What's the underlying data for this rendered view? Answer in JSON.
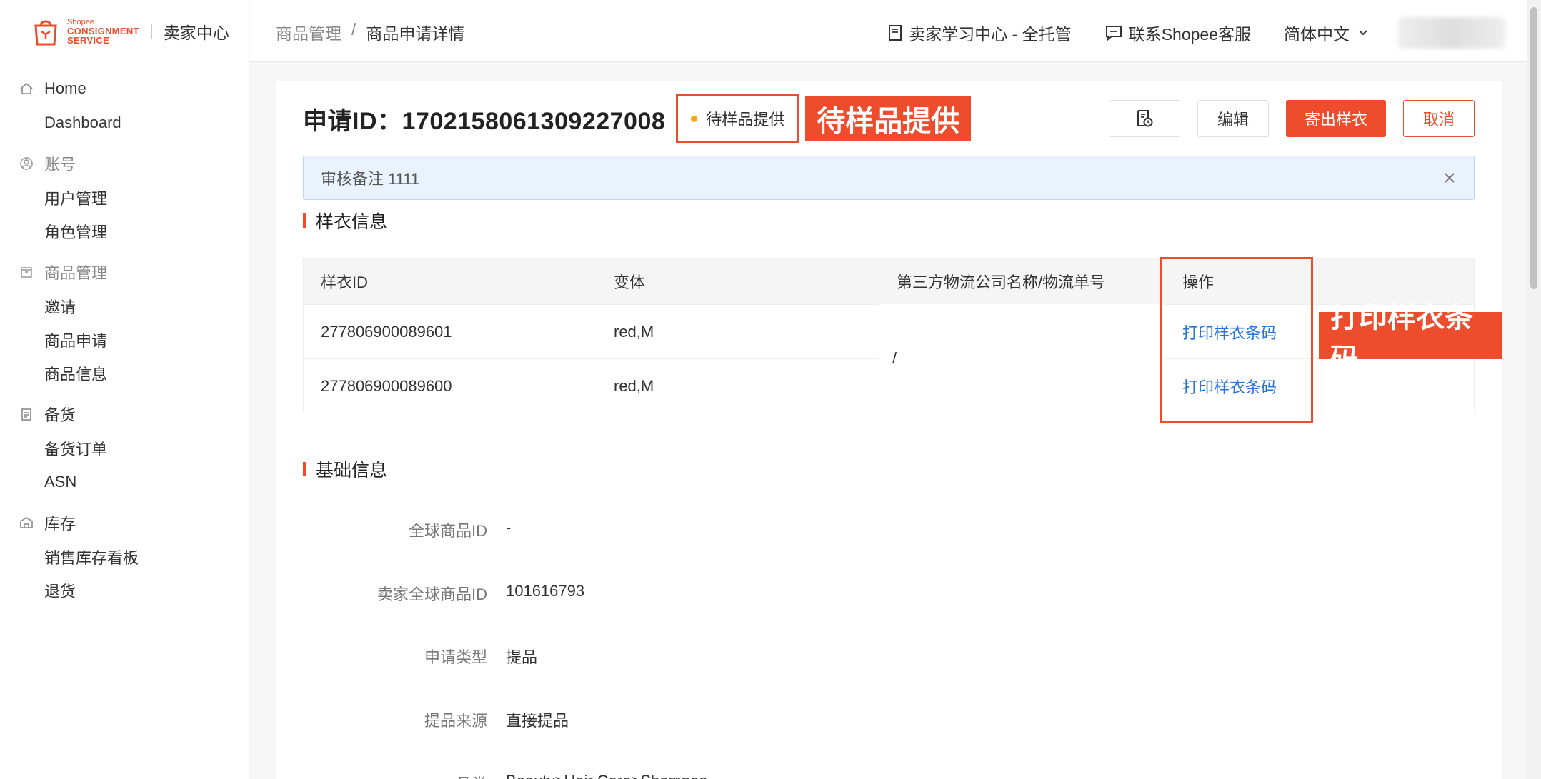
{
  "brand": {
    "logo_small": "Shopee",
    "logo_line1": "CONSIGNMENT",
    "logo_line2": "SERVICE",
    "title": "卖家中心"
  },
  "sidebar": {
    "groups": [
      {
        "label": "Home",
        "icon": "home-icon",
        "muted": false,
        "items": [
          "Dashboard"
        ]
      },
      {
        "label": "账号",
        "icon": "user-circle-icon",
        "muted": true,
        "items": [
          "用户管理",
          "角色管理"
        ]
      },
      {
        "label": "商品管理",
        "icon": "box-icon",
        "muted": true,
        "items": [
          "邀请",
          "商品申请",
          "商品信息"
        ]
      },
      {
        "label": "备货",
        "icon": "clipboard-icon",
        "muted": false,
        "items": [
          "备货订单",
          "ASN"
        ]
      },
      {
        "label": "库存",
        "icon": "warehouse-icon",
        "muted": false,
        "items": [
          "销售库存看板",
          "退货"
        ]
      }
    ]
  },
  "header": {
    "breadcrumb_parent": "商品管理",
    "breadcrumb_sep": "/",
    "breadcrumb_current": "商品申请详情",
    "learning_center": "卖家学习中心 - 全托管",
    "contact_support": "联系Shopee客服",
    "language": "简体中文"
  },
  "detail": {
    "title": "申请ID：1702158061309227008",
    "status": "待样品提供",
    "status_callout": "待样品提供",
    "buttons": {
      "edit": "编辑",
      "ship_sample": "寄出样衣",
      "cancel": "取消"
    },
    "notice": "审核备注 1111"
  },
  "sample_section": {
    "title": "样衣信息",
    "columns": [
      "样衣ID",
      "变体",
      "第三方物流公司名称/物流单号",
      "操作"
    ],
    "rows": [
      {
        "id": "277806900089601",
        "variant": "red,M",
        "action": "打印样衣条码"
      },
      {
        "id": "277806900089600",
        "variant": "red,M",
        "action": "打印样衣条码"
      }
    ],
    "logistics": "/",
    "action_callout": "打印样衣条码"
  },
  "basic_section": {
    "title": "基础信息",
    "fields": [
      {
        "label": "全球商品ID",
        "value": "-"
      },
      {
        "label": "卖家全球商品ID",
        "value": "101616793"
      },
      {
        "label": "申请类型",
        "value": "提品"
      },
      {
        "label": "提品来源",
        "value": "直接提品"
      },
      {
        "label": "品类",
        "value": "Beauty>Hair Care>Shampoo"
      }
    ]
  },
  "colors": {
    "accent": "#ee4d2d",
    "link": "#2673dd",
    "status_dot": "#ffa500",
    "notice_bg": "#eaf3fd"
  }
}
